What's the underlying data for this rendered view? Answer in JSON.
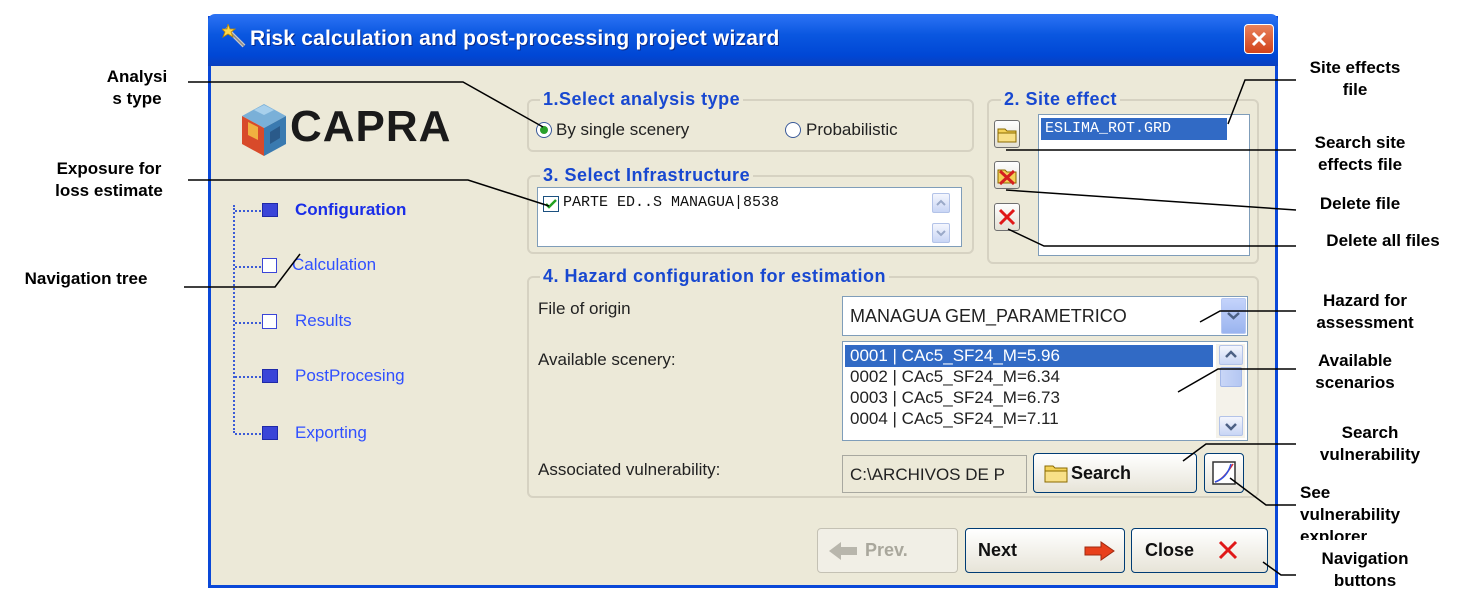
{
  "window": {
    "title": "Risk calculation and post-processing project wizard"
  },
  "logo": {
    "text": "CAPRA"
  },
  "nav_tree": [
    {
      "label": "Configuration",
      "state": "filled",
      "active": true
    },
    {
      "label": "Calculation",
      "state": "empty",
      "active": false
    },
    {
      "label": "Results",
      "state": "empty",
      "active": false
    },
    {
      "label": "PostProcesing",
      "state": "filled",
      "active": false
    },
    {
      "label": "Exporting",
      "state": "filled",
      "active": false
    }
  ],
  "analysis": {
    "title": "1.Select analysis type",
    "option_single": "By single scenery",
    "option_prob": "Probabilistic",
    "selected": "By single scenery"
  },
  "site_effect": {
    "title": "2. Site effect",
    "file": "ESLIMA_ROT.GRD"
  },
  "infrastructure": {
    "title": "3. Select Infrastructure",
    "item": "PARTE ED..S MANAGUA|8538",
    "checked": true
  },
  "hazard": {
    "title": "4. Hazard configuration for estimation",
    "origin_label": "File of origin",
    "origin_value": "MANAGUA GEM_PARAMETRICO",
    "scenery_label": "Available scenery:",
    "sceneries": [
      "0001 | CAc5_SF24_M=5.96",
      "0002 | CAc5_SF24_M=6.34",
      "0003 | CAc5_SF24_M=6.73",
      "0004 | CAc5_SF24_M=7.11"
    ],
    "vuln_label": "Associated vulnerability:",
    "vuln_value": "C:\\ARCHIVOS DE P",
    "search_label": "Search"
  },
  "buttons": {
    "prev": "Prev.",
    "next": "Next",
    "close": "Close"
  },
  "annotations": {
    "analysis_type": "Analysi\ns type",
    "exposure": "Exposure for\nloss estimate",
    "nav_tree": "Navigation tree",
    "site_effects_file": "Site effects\nfile",
    "search_site": "Search site\neffects file",
    "delete_file": "Delete file",
    "delete_all": "Delete all files",
    "hazard": "Hazard for\nassessment",
    "scenarios": "Available\nscenarios",
    "search_vuln": "Search\nvulnerability",
    "see_vuln": "See\nvulnerability\nexplorer",
    "nav_buttons": "Navigation\nbuttons"
  },
  "colors": {
    "titlebar": "#0047d5",
    "group_title": "#1848d0",
    "selection": "#316ac5",
    "window_bg": "#ece9d8"
  }
}
